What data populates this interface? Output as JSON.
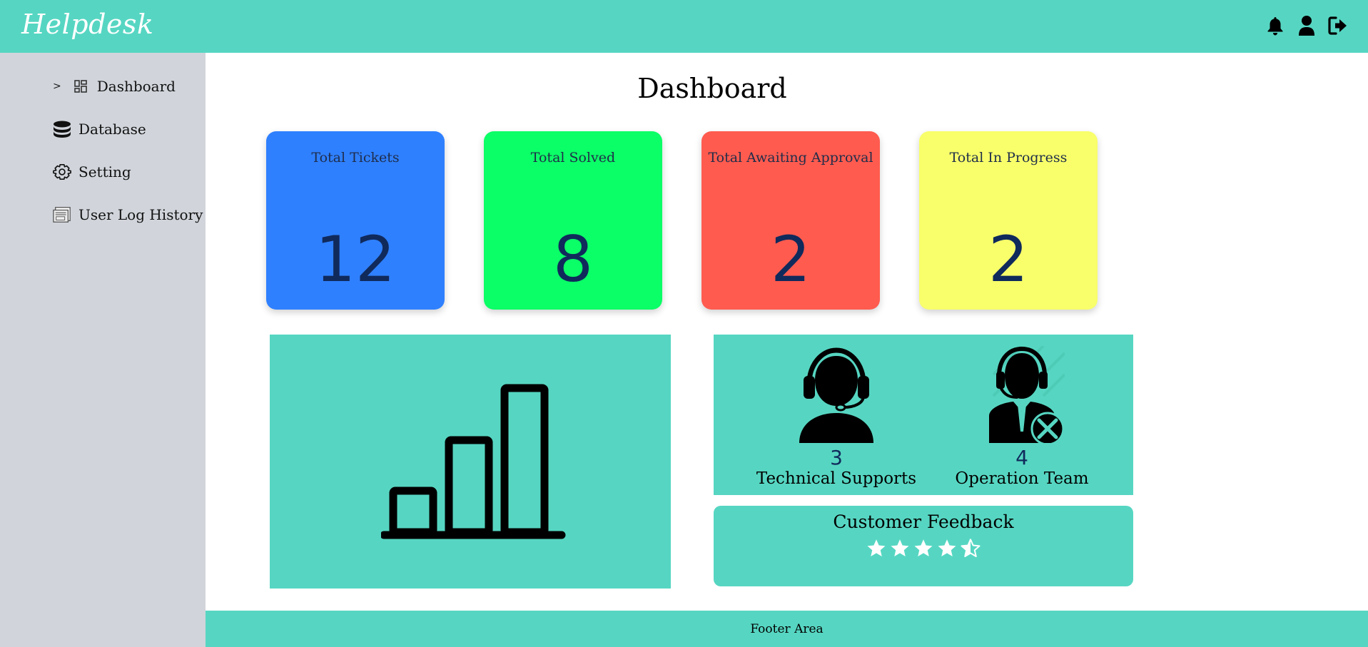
{
  "header": {
    "brand": "Helpdesk",
    "icons": [
      "bell-icon",
      "user-icon",
      "logout-icon"
    ]
  },
  "sidebar": {
    "items": [
      {
        "label": "Dashboard",
        "icon": "dashboard-grid-icon",
        "active": true,
        "indicator": ">"
      },
      {
        "label": "Database",
        "icon": "database-icon"
      },
      {
        "label": "Setting",
        "icon": "gear-icon"
      },
      {
        "label": "User Log History",
        "icon": "log-icon"
      }
    ]
  },
  "main": {
    "title": "Dashboard",
    "stats": [
      {
        "label": "Total Tickets",
        "value": "12",
        "color": "#2f80ff"
      },
      {
        "label": "Total Solved",
        "value": "8",
        "color": "#0bff66"
      },
      {
        "label": "Total Awaiting Approval",
        "value": "2",
        "color": "#ff5b4f"
      },
      {
        "label": "Total In Progress",
        "value": "2",
        "color": "#f8ff6a"
      }
    ],
    "chart_icon": "bar-chart-icon",
    "teams": [
      {
        "count": "3",
        "label": "Technical Supports",
        "icon": "headset-support-icon"
      },
      {
        "count": "4",
        "label": "Operation Team",
        "icon": "operator-tools-icon"
      }
    ],
    "feedback": {
      "title": "Customer Feedback",
      "rating": 4.5,
      "max": 5
    }
  },
  "footer": {
    "text": "Footer Area"
  },
  "colors": {
    "accent": "#56d6c2",
    "sidebar_bg": "#d1d5db",
    "number_color": "#102a5c"
  }
}
